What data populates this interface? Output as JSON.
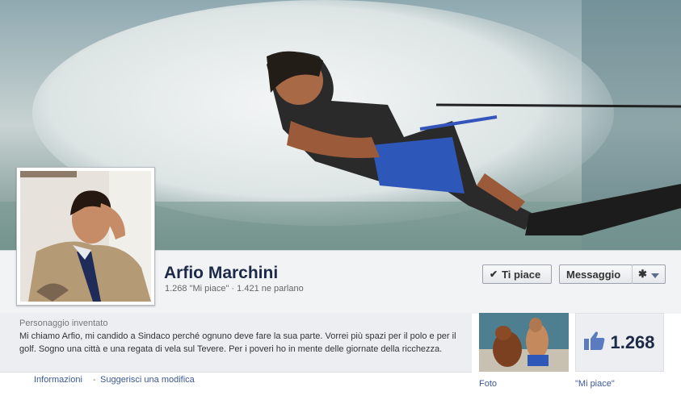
{
  "page": {
    "name": "Arfio Marchini",
    "likes_text": "1.268 \"Mi piace\"",
    "talking_text": "1.421 ne parlano",
    "separator": "·"
  },
  "actions": {
    "like_label": "Ti piace",
    "message_label": "Messaggio"
  },
  "about": {
    "category": "Personaggio inventato",
    "description": "Mi chiamo Arfio, mi candido a Sindaco perché ognuno deve fare la sua parte. Vorrei più spazi per il polo e per il golf. Sogno una città e una regata di vela sul Tevere. Per i poveri ho in mente delle giornate della ricchezza."
  },
  "links": {
    "info": "Informazioni",
    "separator": "-",
    "suggest": "Suggerisci una modifica"
  },
  "apps": {
    "photos_label": "Foto",
    "likes_label": "\"Mi piace\"",
    "likes_count": "1.268"
  },
  "icons": {
    "like_button": "check-icon",
    "settings": "gear-icon",
    "dropdown": "caret-down-icon",
    "likes_box": "thumbs-up-icon"
  },
  "colors": {
    "link": "#3b5998",
    "title": "#1c2a47"
  }
}
